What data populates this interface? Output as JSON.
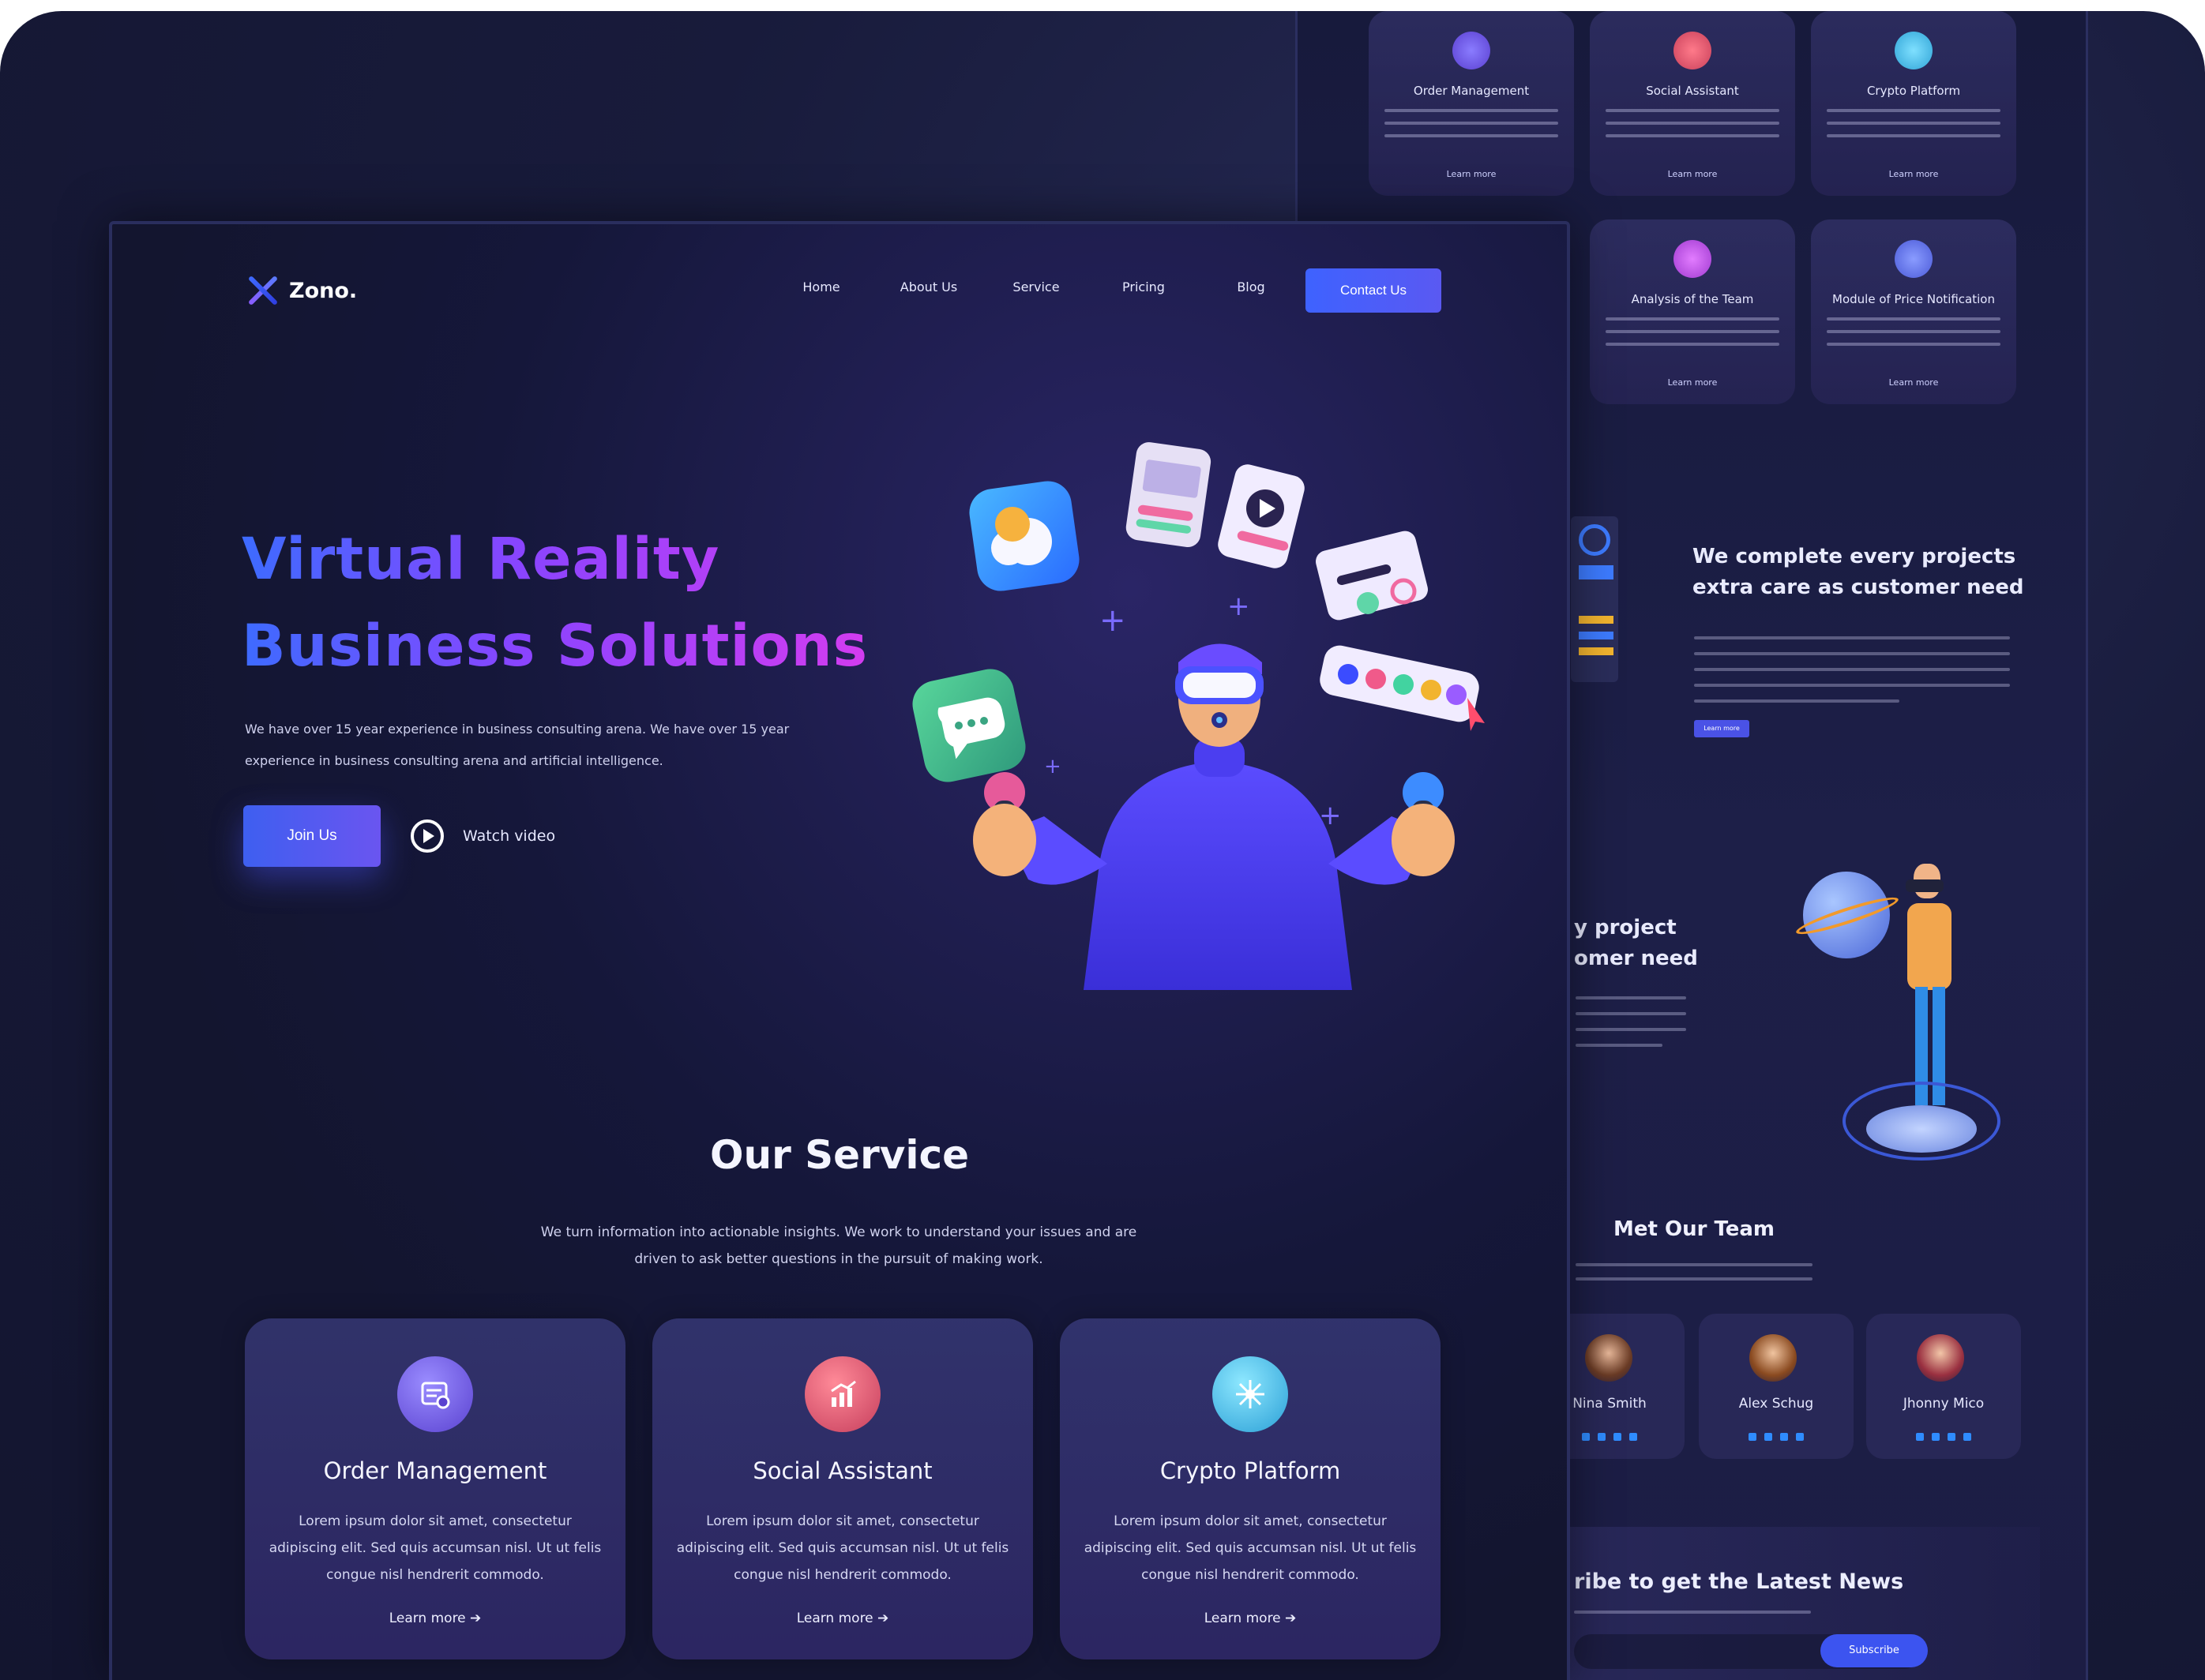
{
  "colors": {
    "accent": "#3e62ff",
    "gradient_start": "#3d6bff",
    "gradient_end": "#d33cf0",
    "background": "#13152f"
  },
  "brand": {
    "name": "Zono."
  },
  "nav": {
    "items": [
      "Home",
      "About Us",
      "Service",
      "Pricing",
      "Blog"
    ],
    "contact_label": "Contact Us"
  },
  "hero": {
    "title_line1": "Virtual Reality",
    "title_line2": "Business Solutions",
    "description": "We have over 15 year experience in business consulting arena. We have over 15 year experience in business consulting arena and artificial intelligence.",
    "join_label": "Join Us",
    "watch_label": "Watch video"
  },
  "service": {
    "title": "Our Service",
    "description": "We turn information into actionable insights. We work to understand your issues and are driven to ask better questions in the pursuit of making work.",
    "cards": [
      {
        "title": "Order Management",
        "text": "Lorem ipsum dolor sit amet, consectetur adipiscing elit. Sed quis accumsan nisl. Ut ut felis congue nisl hendrerit commodo.",
        "link": "Learn more",
        "icon": "order-icon"
      },
      {
        "title": "Social Assistant",
        "text": "Lorem ipsum dolor sit amet, consectetur adipiscing elit. Sed quis accumsan nisl. Ut ut felis congue nisl hendrerit commodo.",
        "link": "Learn more",
        "icon": "chart-icon"
      },
      {
        "title": "Crypto Platform",
        "text": "Lorem ipsum dolor sit amet, consectetur adipiscing elit. Sed quis accumsan nisl. Ut ut felis congue nisl hendrerit commodo.",
        "link": "Learn more",
        "icon": "network-icon"
      }
    ]
  },
  "bg_page": {
    "cards": [
      {
        "title": "Order Management",
        "link": "Learn more"
      },
      {
        "title": "Social Assistant",
        "link": "Learn more"
      },
      {
        "title": "Crypto Platform",
        "link": "Learn more"
      },
      {
        "title": "Analysis of the Team",
        "link": "Learn more"
      },
      {
        "title": "Module of Price Notification",
        "link": "Learn more"
      }
    ],
    "feature_heading_line1": "We complete every projects",
    "feature_heading_line2": "extra care as customer need",
    "feature_button": "Learn more",
    "feature2_line1": "y project",
    "feature2_line2": "omer need",
    "team_title": "Met Our Team",
    "team": [
      {
        "name": "Nina Smith"
      },
      {
        "name": "Alex Schug"
      },
      {
        "name": "Jhonny Mico"
      }
    ],
    "newsletter_title": "ribe to get the Latest News",
    "subscribe_label": "Subscribe"
  }
}
